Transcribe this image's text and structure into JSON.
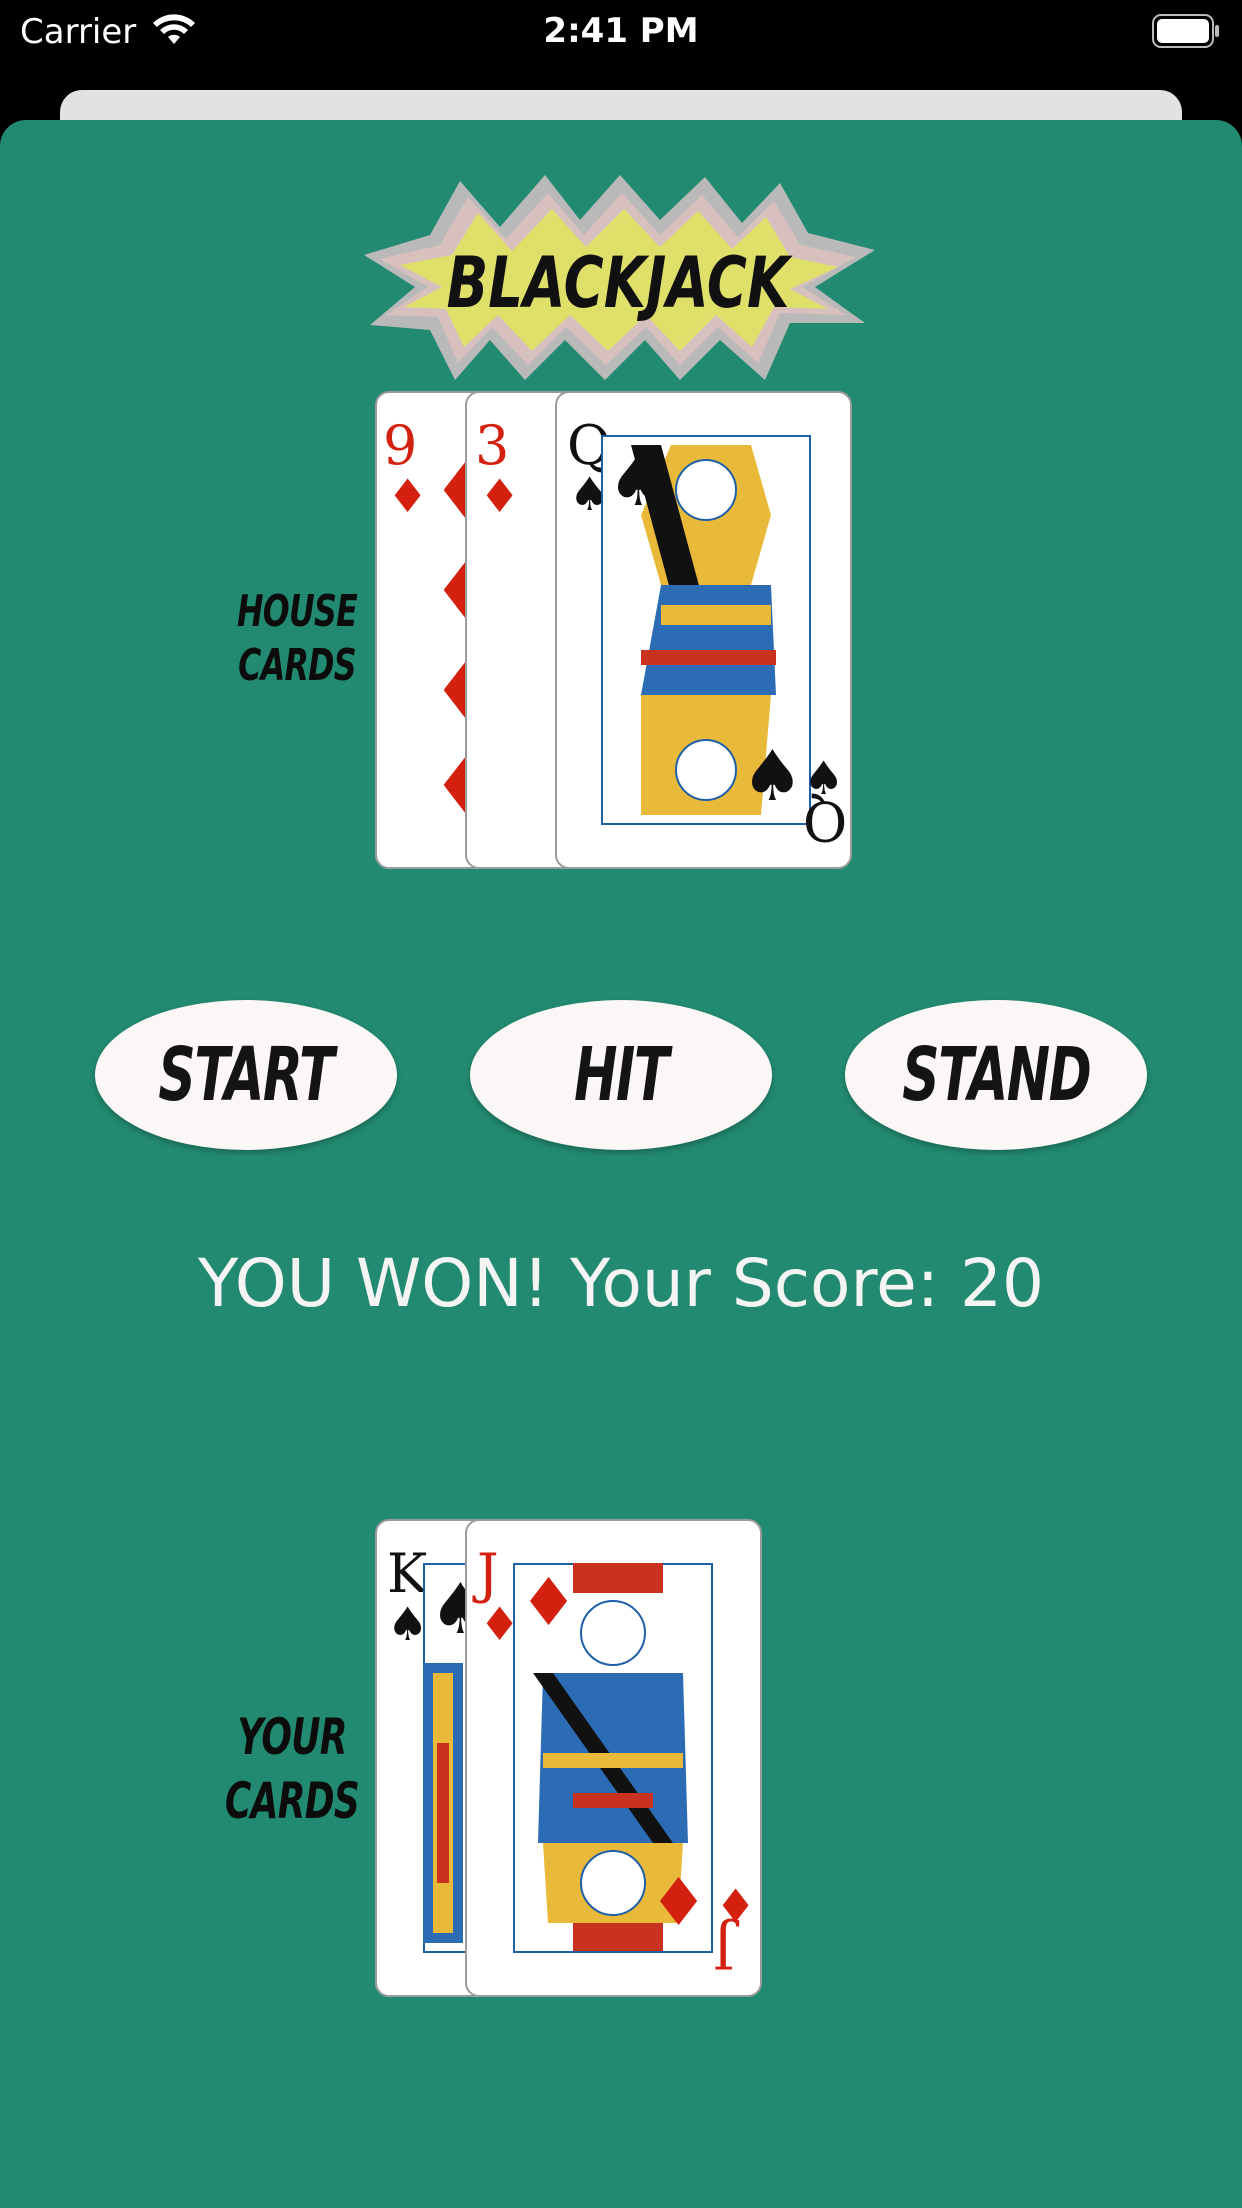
{
  "status_bar": {
    "carrier": "Carrier",
    "time": "2:41 PM"
  },
  "logo": {
    "text": "BLACKJACK"
  },
  "house": {
    "label_line1": "HOUSE",
    "label_line2": "CARDS",
    "cards": [
      {
        "rank": "9",
        "suit": "♦",
        "color": "red"
      },
      {
        "rank": "3",
        "suit": "♦",
        "color": "red"
      },
      {
        "rank": "Q",
        "suit": "♠",
        "color": "black"
      }
    ]
  },
  "buttons": {
    "start": "START",
    "hit": "HIT",
    "stand": "STAND"
  },
  "result_text": "YOU WON! Your Score: 20",
  "player": {
    "label_line1": "YOUR",
    "label_line2": "CARDS",
    "cards": [
      {
        "rank": "K",
        "suit": "♠",
        "color": "black"
      },
      {
        "rank": "J",
        "suit": "♦",
        "color": "red"
      }
    ]
  },
  "colors": {
    "table_green": "#228a70",
    "card_red": "#d3200f",
    "logo_yellow": "#dfe06a"
  }
}
